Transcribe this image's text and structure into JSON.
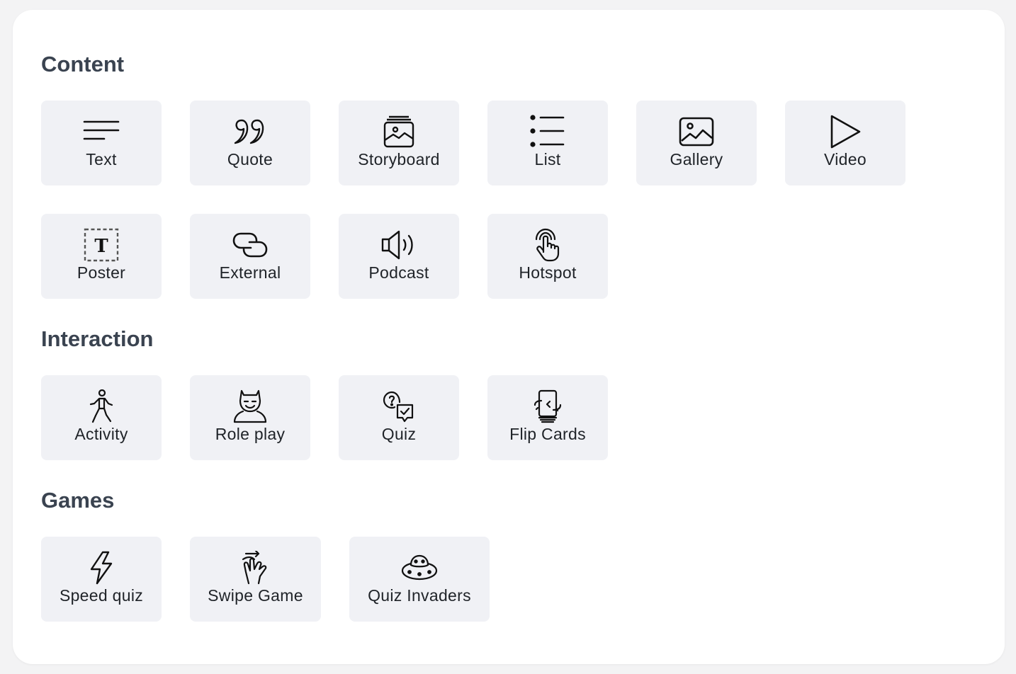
{
  "sections": [
    {
      "title": "Content",
      "rows": [
        [
          {
            "label": "Text",
            "icon": "text-lines-icon"
          },
          {
            "label": "Quote",
            "icon": "quote-icon"
          },
          {
            "label": "Storyboard",
            "icon": "storyboard-icon"
          },
          {
            "label": "List",
            "icon": "bullet-list-icon"
          },
          {
            "label": "Gallery",
            "icon": "image-icon"
          },
          {
            "label": "Video",
            "icon": "play-icon"
          }
        ],
        [
          {
            "label": "Poster",
            "icon": "poster-icon",
            "icon_text": "T"
          },
          {
            "label": "External",
            "icon": "link-icon"
          },
          {
            "label": "Podcast",
            "icon": "speaker-icon"
          },
          {
            "label": "Hotspot",
            "icon": "tap-icon"
          }
        ]
      ]
    },
    {
      "title": "Interaction",
      "rows": [
        [
          {
            "label": "Activity",
            "icon": "walking-person-icon"
          },
          {
            "label": "Role play",
            "icon": "mask-icon"
          },
          {
            "label": "Quiz",
            "icon": "question-check-icon"
          },
          {
            "label": "Flip Cards",
            "icon": "flip-card-icon"
          }
        ]
      ]
    },
    {
      "title": "Games",
      "rows": [
        [
          {
            "label": "Speed quiz",
            "icon": "lightning-icon"
          },
          {
            "label": "Swipe Game",
            "icon": "swipe-hand-icon"
          },
          {
            "label": "Quiz Invaders",
            "icon": "ufo-icon"
          }
        ]
      ]
    }
  ]
}
